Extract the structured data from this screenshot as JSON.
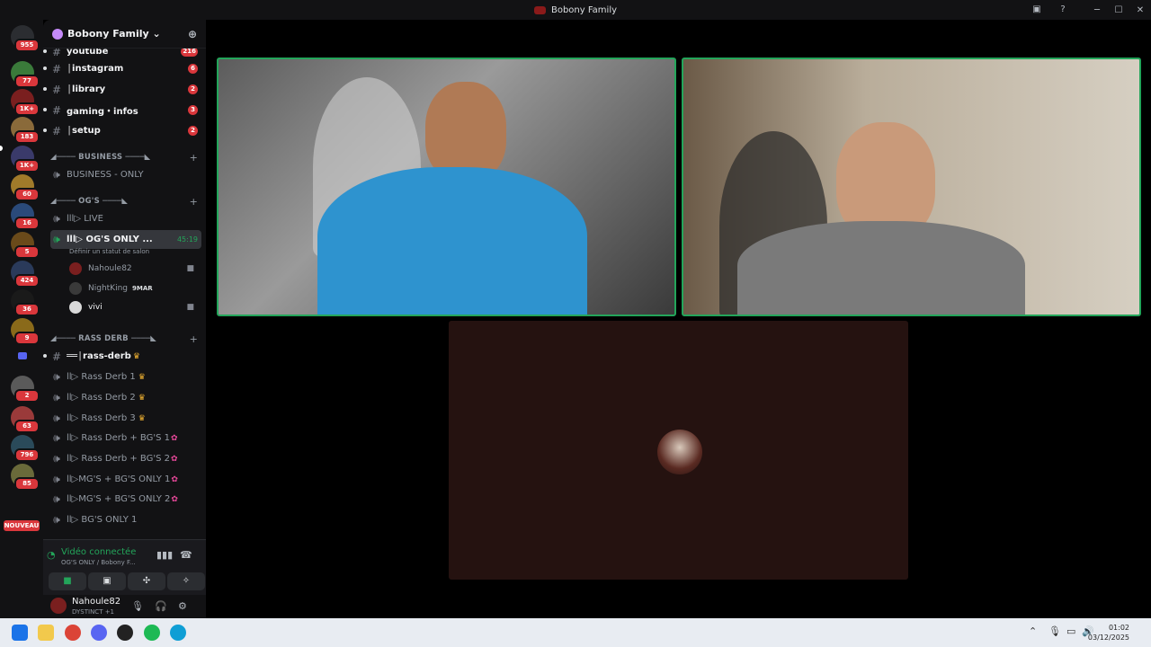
{
  "window": {
    "title": "Bobony Family"
  },
  "guilds": [
    {
      "badge": "955"
    },
    {
      "badge": "77"
    },
    {
      "badge": "1K+"
    },
    {
      "badge": "183"
    },
    {
      "badge": "1K+"
    },
    {
      "badge": "60"
    },
    {
      "badge": "16"
    },
    {
      "badge": "5"
    },
    {
      "badge": "424"
    },
    {
      "badge": "36"
    },
    {
      "badge": "9"
    },
    {
      "badge": ""
    },
    {
      "badge": "2"
    },
    {
      "badge": "63"
    },
    {
      "badge": "796"
    },
    {
      "badge": "85"
    }
  ],
  "guilds_new_label": "NOUVEAU",
  "server": {
    "name": "Bobony Family ⌄"
  },
  "channels": {
    "youtube": {
      "label": "youtube",
      "count": "216"
    },
    "instagram": {
      "label": "│instagram",
      "count": "6"
    },
    "library": {
      "label": "│library",
      "count": "2"
    },
    "gaming": {
      "label": "gaming・infos",
      "count": "3"
    },
    "setup": {
      "label": "│setup",
      "count": "2"
    },
    "cat_business": "◢──── BUSINESS ────◣",
    "business_only": "BUSINESS - ONLY",
    "cat_ogs": "◢──── OG'S ────◣",
    "live": "lll▷ LIVE",
    "ogs_only": {
      "label": "lll▷ OG'S ONLY ...",
      "time": "45:19",
      "status": "Définir un statut de salon"
    },
    "cat_rass": "◢──── RASS DERB ────◣",
    "rass_derb_text": "══│rass-derb",
    "rass_derb_1": "ll▷ Rass Derb 1",
    "rass_derb_2": "ll▷ Rass Derb 2",
    "rass_derb_3": "ll▷ Rass Derb 3",
    "rass_bgs_1": "ll▷ Rass Derb + BG'S 1",
    "rass_bgs_2": "ll▷ Rass Derb + BG'S 2",
    "mgs_1": "ll▷MG'S + BG'S ONLY 1",
    "mgs_2": "ll▷MG'S + BG'S ONLY 2",
    "bgs_only": "ll▷ BG'S ONLY 1"
  },
  "voice_users": [
    {
      "name": "Nahoule82",
      "tag": ""
    },
    {
      "name": "NightKing",
      "tag": "9MAR"
    },
    {
      "name": "vivi",
      "tag": ""
    }
  ],
  "voice_panel": {
    "status": "Vidéo connectée",
    "channel": "OG'S ONLY / Bobony F..."
  },
  "user": {
    "name": "Nahoule82",
    "status": "DYSTINCT +1"
  },
  "clock": {
    "time": "01:02",
    "date": "03/12/2025"
  },
  "colors": {
    "connected": "#23a55a",
    "badge": "#da373c",
    "sidebar": "#121214"
  }
}
